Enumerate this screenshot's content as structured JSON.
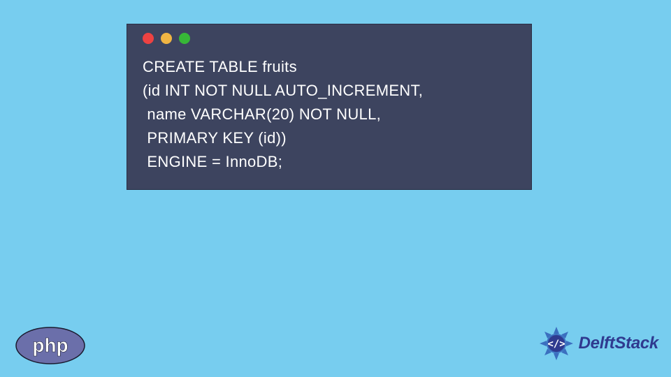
{
  "window": {
    "traffic_lights": [
      "red",
      "yellow",
      "green"
    ]
  },
  "code": {
    "lines": [
      "CREATE TABLE fruits",
      "(id INT NOT NULL AUTO_INCREMENT,",
      " name VARCHAR(20) NOT NULL,",
      " PRIMARY KEY (id))",
      " ENGINE = InnoDB;"
    ]
  },
  "logos": {
    "php_label": "php",
    "delft_label": "DelftStack"
  },
  "colors": {
    "page_bg": "#77cdef",
    "window_bg": "#3d445f",
    "code_text": "#ffffff",
    "delft_primary": "#2f3a8f",
    "delft_accent": "#3b6fbf",
    "php_fill": "#6b6faa",
    "dot_red": "#ed4242",
    "dot_yellow": "#f0b543",
    "dot_green": "#37b737"
  }
}
